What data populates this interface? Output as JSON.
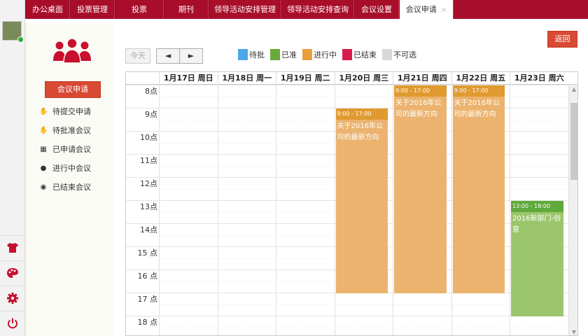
{
  "tabs": [
    {
      "label": "办公桌面",
      "w": 64
    },
    {
      "label": "投票管理",
      "w": 64
    },
    {
      "label": "投票",
      "w": 70
    },
    {
      "label": "期刊",
      "w": 64
    },
    {
      "label": "领导活动安排管理",
      "w": 104
    },
    {
      "label": "领导活动安排查询",
      "w": 104
    },
    {
      "label": "会议设置",
      "w": 64
    },
    {
      "label": "会议申请",
      "w": 78,
      "active": true
    }
  ],
  "tab_close": "×",
  "sidebar": {
    "apply_label": "会议申请",
    "items": [
      {
        "label": "待提交申请",
        "icon": "hand-icon"
      },
      {
        "label": "待批准会议",
        "icon": "hand-icon"
      },
      {
        "label": "已申请会议",
        "icon": "calendar-icon"
      },
      {
        "label": "进行中会议",
        "icon": "user-icon"
      },
      {
        "label": "已结束会议",
        "icon": "stop-icon"
      }
    ]
  },
  "leftbar_icons": [
    "shirt-icon",
    "palette-icon",
    "gear-icon",
    "power-icon"
  ],
  "toolbar": {
    "back_label": "返回",
    "today_label": "今天",
    "prev_label": "◄",
    "next_label": "►"
  },
  "legend": [
    {
      "label": "待批",
      "color": "#4aa8e8"
    },
    {
      "label": "已准",
      "color": "#6aaa3a"
    },
    {
      "label": "进行中",
      "color": "#e8a03a"
    },
    {
      "label": "已结束",
      "color": "#d81a4a"
    },
    {
      "label": "不可选",
      "color": "#d8d8d8"
    }
  ],
  "calendar": {
    "days": [
      "1月17日 周日",
      "1月18日 周一",
      "1月19日 周二",
      "1月20日 周三",
      "1月21日 周四",
      "1月22日 周五",
      "1月23日 周六"
    ],
    "hours": [
      "8点",
      "9点",
      "10点",
      "11点",
      "12点",
      "13点",
      "14点",
      "15 点",
      "16 点",
      "17 点",
      "18 点"
    ],
    "events": [
      {
        "day": 3,
        "time": "9:00 - 17:00",
        "title": "关于2016年公司的最新方向",
        "status": "进行中",
        "start": 9,
        "end": 17,
        "header_color": "#e09a30",
        "body_color": "#ebb36e"
      },
      {
        "day": 4,
        "time": "9:00 - 17:00",
        "title": "关于2016年公司的最新方向",
        "status": "进行中",
        "start": 8,
        "end": 17,
        "header_color": "#e09a30",
        "body_color": "#ebb36e"
      },
      {
        "day": 5,
        "time": "9:00 - 17:00",
        "title": "关于2016年公司的最新方向",
        "status": "进行中",
        "start": 8,
        "end": 17,
        "header_color": "#e09a30",
        "body_color": "#ebb36e"
      },
      {
        "day": 6,
        "time": "13:00 - 18:00",
        "title": "2016新部门-创意",
        "status": "已准",
        "start": 13,
        "end": 18,
        "header_color": "#5faa3a",
        "body_color": "#9bc66b"
      }
    ]
  }
}
